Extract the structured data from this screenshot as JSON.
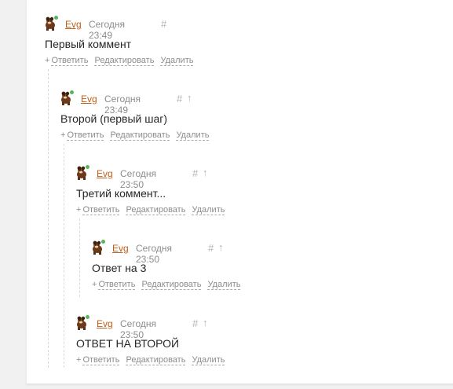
{
  "colors": {
    "author": "#c05e18",
    "meta": "#8c8c8c",
    "online": "#56b556"
  },
  "icons": {
    "avatar": "dog-avatar-icon",
    "hash": "hash-link-icon",
    "up": "arrow-up-icon"
  },
  "labels": {
    "reply": "Ответить",
    "edit": "Редактировать",
    "delete": "Удалить",
    "hash": "#",
    "up": "↑",
    "plus": "+"
  },
  "comments": [
    {
      "author": "Evg",
      "date": "Сегодня 23:49",
      "text": "Первый коммент"
    },
    {
      "author": "Evg",
      "date": "Сегодня 23:49",
      "text": "Второй (первый шаг)"
    },
    {
      "author": "Evg",
      "date": "Сегодня 23:50",
      "text": "Третий коммент..."
    },
    {
      "author": "Evg",
      "date": "Сегодня 23:50",
      "text": "Ответ на 3"
    },
    {
      "author": "Evg",
      "date": "Сегодня 23:50",
      "text": "ОТВЕТ НА ВТОРОЙ"
    }
  ]
}
